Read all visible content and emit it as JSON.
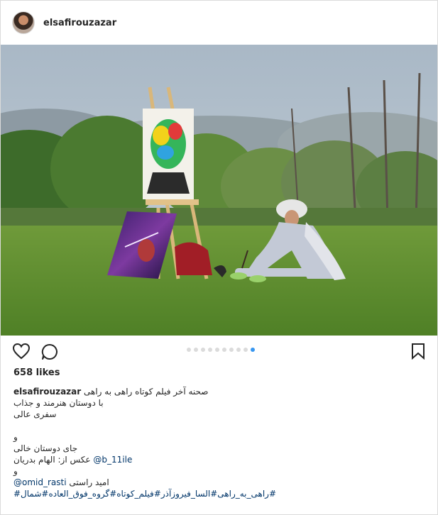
{
  "post": {
    "username": "elsafirouzazar",
    "likes": "658 likes",
    "caption_user": "elsafirouzazar",
    "caption_line1": "صحنه آخر فیلم کوتاه راهی به راهی",
    "caption_line2": "با دوستان هنرمند و جذاب",
    "caption_line3": "سفری عالی",
    "caption_line4": "و",
    "caption_line5": "جای دوستان خالی",
    "photo_credit_text": "عکس از: الهام بدریان",
    "photo_credit_handle": "@b_11ile",
    "caption_line7": "و",
    "credit2_handle": "@omid_rasti",
    "credit2_text": "امید راستی",
    "hashtags": "#راهی_به_راهی#السا_فیروزآذر#فیلم_کوتاه#گروه_فوق_العاده#شمال#"
  },
  "carousel": {
    "count": 10,
    "active_index": 9
  },
  "icons": {
    "like": "heart-icon",
    "comment": "comment-icon",
    "save": "bookmark-icon"
  },
  "colors": {
    "active_dot": "#3897f0",
    "link": "#003569",
    "border": "#dbdbdb"
  }
}
